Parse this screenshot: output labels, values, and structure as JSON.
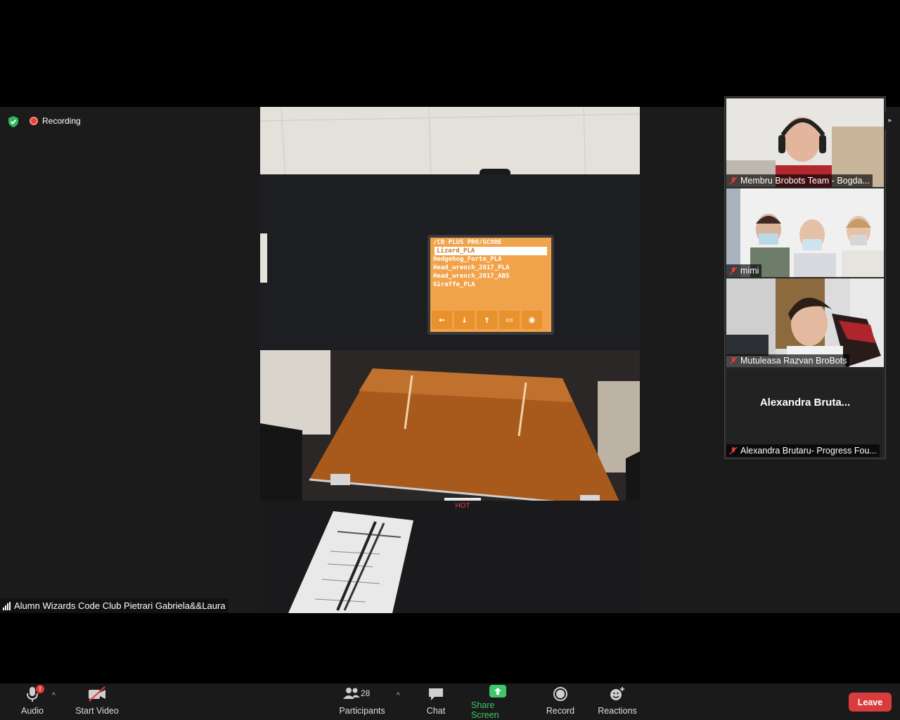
{
  "status": {
    "recording_label": "Recording",
    "security_icon": "shield-check-icon"
  },
  "main_video": {
    "speaker_name": "Alumn Wizards Code Club Pietrari Gabriela&&Laura",
    "printer_screen": {
      "path": "/CB PLUS PRO/GCODE",
      "files": [
        "Lizard_PLA",
        "Hedgehog_Forte_PLA",
        "Head_wrench_2017_PLA",
        "Head_wrench_2017_ABS",
        "Giraffe_PLA"
      ]
    },
    "bed_label": "HOT"
  },
  "gallery": [
    {
      "name": "Membru Brobots Team - Bogda...",
      "muted": true
    },
    {
      "name": "mimi",
      "muted": true
    },
    {
      "name": "Mutuleasa Razvan BroBots",
      "muted": true
    },
    {
      "display_name": "Alexandra  Bruta...",
      "name": "Alexandra Brutaru- Progress Fou...",
      "muted": true
    }
  ],
  "toolbar": {
    "audio_label": "Audio",
    "audio_badge": "!",
    "start_video_label": "Start Video",
    "participants_label": "Participants",
    "participants_count": "28",
    "chat_label": "Chat",
    "share_screen_label": "Share Screen",
    "record_label": "Record",
    "reactions_label": "Reactions",
    "leave_label": "Leave"
  },
  "colors": {
    "share_green": "#3ec86a",
    "leave_red": "#d83c3c",
    "muted_red": "#e53935"
  }
}
